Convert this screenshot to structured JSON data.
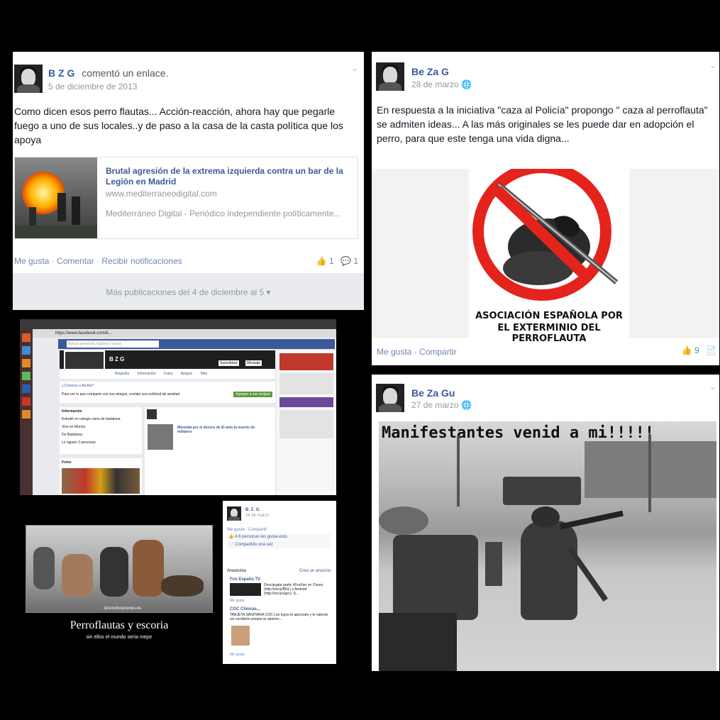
{
  "post1": {
    "author": "B        Z          G",
    "action": "comentó un enlace.",
    "date": "5 de diciembre de 2013",
    "text": "Como dicen esos perro flautas... Acción-reacción, ahora hay que pegarle fuego a uno de sus locales..y de paso a la casa de la casta política que los apoya",
    "link_title": "Brutal agresión de la extrema izquierda contra un bar de la Legión en Madrid",
    "link_domain": "www.mediterraneodigital.com",
    "link_desc": "Mediterráneo Digital - Periódico independiente políticamente...",
    "actions": [
      "Me gusta",
      "Comentar",
      "Recibir notificaciones"
    ],
    "likes": "1",
    "comments": "1",
    "more": "Más publicaciones del 4 de diciembre al 5"
  },
  "post2": {
    "author": "Be        Za        G",
    "date": "28 de marzo",
    "text": "En respuesta a la iniciativa \"caza al Policía\" propongo \" caza al perroflauta\" se admiten ideas... A las más originales se les puede dar en adopción el perro, para que este tenga una vida digna...",
    "image_caption_line1": "ASOCIACIÓN ESPAÑOLA POR",
    "image_caption_line2": "EL EXTERMINIO DEL PERROFLAUTA",
    "actions": [
      "Me gusta",
      "Compartir"
    ],
    "likes": "9"
  },
  "post3": {
    "author": "Be       Za         Gu",
    "date": "27 de marzo",
    "image_text": "Manifestantes venid a mi!!!!!"
  },
  "screenshot_profile": {
    "search_placeholder": "Buscar personas, lugares y cosas",
    "profile_name": "B        Z        G",
    "tabs": [
      "Biografía",
      "Información",
      "Fotos",
      "Amigos",
      "Más"
    ],
    "subscribe": "Suscribirse",
    "message": "Mensaje",
    "know_q": "¿Conoces a Benito?",
    "know_text": "Para ver lo que comparte con sus amigos, envíale una solicitud de amistad.",
    "add_friend": "Agregar a mis amigos",
    "info_title": "Información",
    "info_items": [
      "Estudió en colegio rama de badalona",
      "Vive en Murcia",
      "De Badalona",
      "Le siguen 2 personas"
    ],
    "photos_title": "Fotos",
    "post_headline": "Moisidat por el decoro de EI ante la muerte de militares",
    "url": "https://www.facebook.com/b..."
  },
  "screenshot_share": {
    "author": "B.       Z.       G.",
    "date": "24 de marzo",
    "actions": "Me gusta · Compartir",
    "likes_text": "A 6 personas les gusta esto.",
    "shares_text": "Compartido una vez",
    "ads_title": "Anuncios",
    "ads_create": "Crea un anuncio",
    "ad1_title": "Fox España TV",
    "ad1_text": "Descárgate gratis #FoxFan en iTunes (http://ow.ly/BNL) y Android (http://ow.ly/ugzc). S...",
    "ad2_title": "COC Clinicas...",
    "ad2_text": "TARJETA SANITARIA COC Los tuyos te apreciam y te valoran sin condición porque te quieren...",
    "like": "Me gusta"
  },
  "meme": {
    "watermark": "desmotivaciones.es",
    "title": "Perroflautas y escoria",
    "subtitle": "sin ellos el mundo sería mejor"
  }
}
